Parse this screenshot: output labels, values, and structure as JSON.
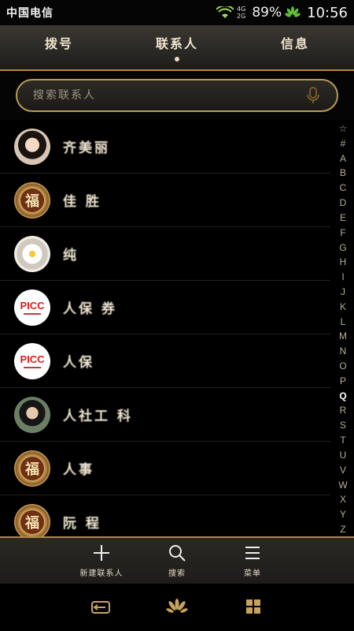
{
  "status": {
    "carrier": "中国电信",
    "net_top": "4G",
    "net_bottom": "2G",
    "battery": "89%",
    "time": "10:56"
  },
  "tabs": [
    {
      "label": "拨号"
    },
    {
      "label": "联系人"
    },
    {
      "label": "信息"
    }
  ],
  "search": {
    "placeholder": "搜索联系人"
  },
  "contacts": [
    {
      "name": "齐美丽"
    },
    {
      "name": "佳  胜"
    },
    {
      "name": "  纯"
    },
    {
      "name": "人保   券"
    },
    {
      "name": "人保"
    },
    {
      "name": "人社工   科"
    },
    {
      "name": "人事"
    },
    {
      "name": "阮 程"
    }
  ],
  "index_letters": [
    "☆",
    "#",
    "A",
    "B",
    "C",
    "D",
    "E",
    "F",
    "G",
    "H",
    "I",
    "J",
    "K",
    "L",
    "M",
    "N",
    "O",
    "P",
    "Q",
    "R",
    "S",
    "T",
    "U",
    "V",
    "W",
    "X",
    "Y",
    "Z"
  ],
  "actions": [
    {
      "label": "新建联系人"
    },
    {
      "label": "搜索"
    },
    {
      "label": "菜单"
    }
  ],
  "avatar_text": {
    "fu": "福",
    "picc": "PICC"
  },
  "colors": {
    "accent": "#b08a3e",
    "background": "#000000"
  }
}
